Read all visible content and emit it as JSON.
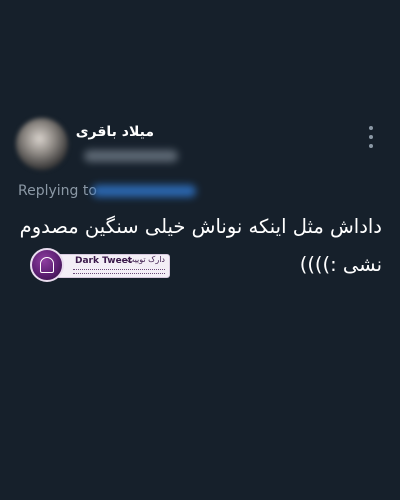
{
  "tweet": {
    "author": {
      "display_name": "میلاد باقری",
      "avatar_icon": "profile-photo"
    },
    "replying_to_label": "Replying to",
    "text_lines": [
      "داداش مثل اینکه نوناش خیلی سنگین مصدوم",
      "نشی :))))"
    ],
    "more_icon": "vertical-ellipsis-icon"
  },
  "watermark": {
    "logo_text": "Dark Tweet",
    "logo_text_fa": "دارک توییت"
  },
  "colors": {
    "background": "#16202b",
    "primary_text": "#ffffff",
    "secondary_text": "#8b98a5",
    "link": "#1d9bf0"
  }
}
